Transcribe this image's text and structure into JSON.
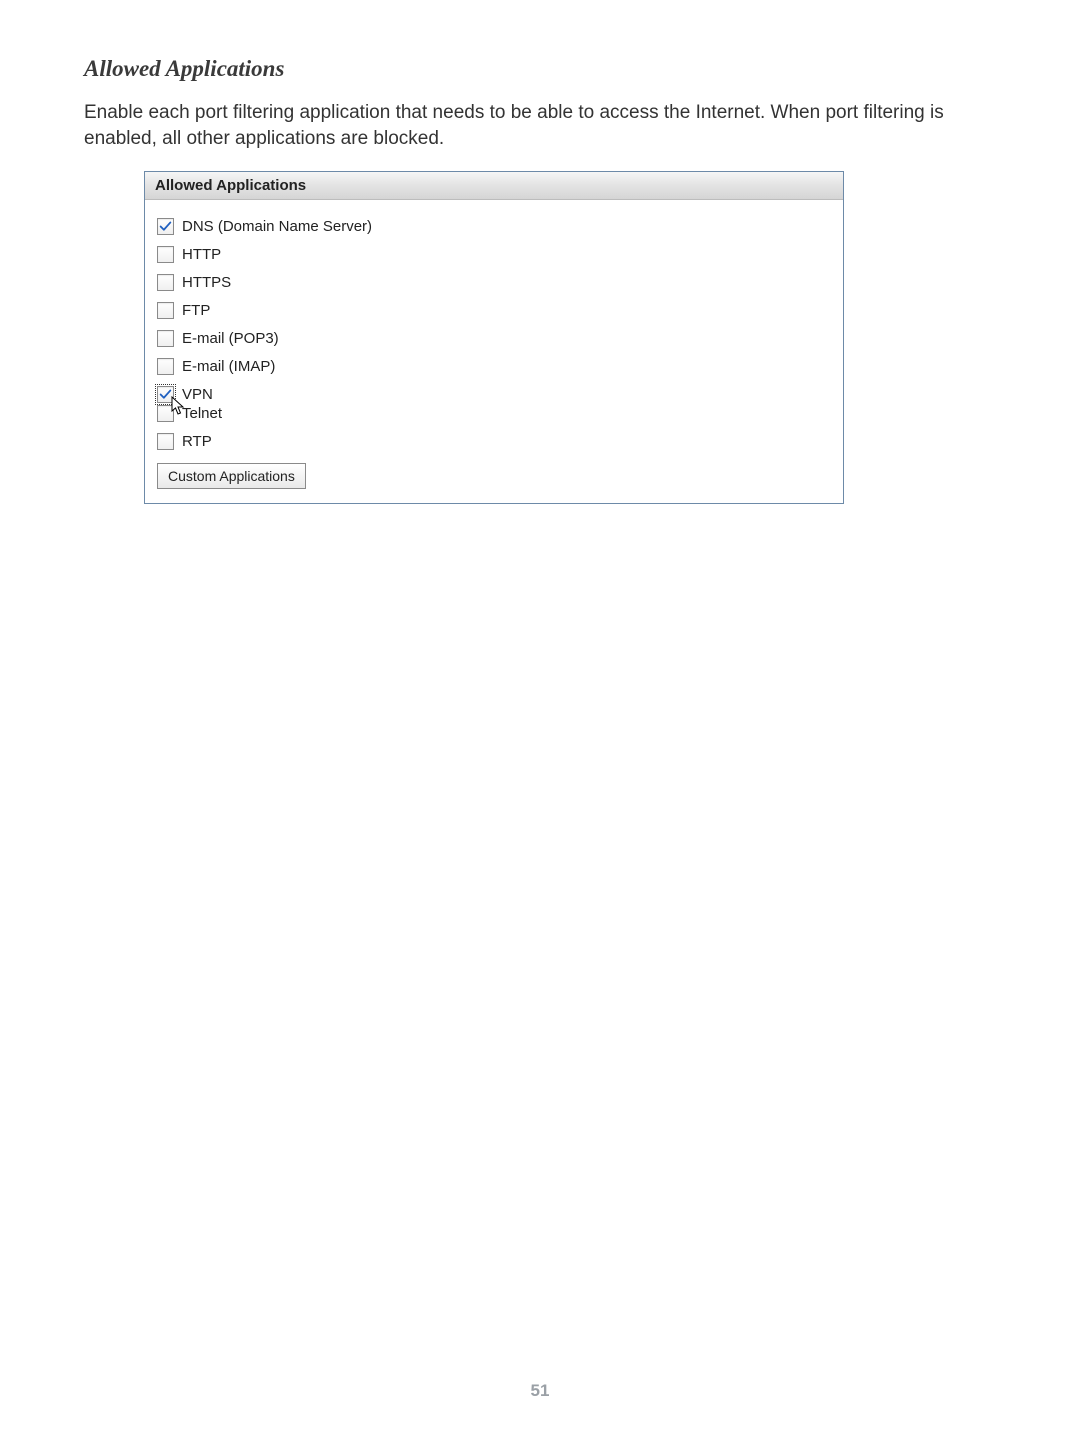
{
  "section": {
    "title": "Allowed Applications",
    "description": "Enable each port filtering application that needs to be able to access the Internet. When port filtering is enabled, all other applications are blocked."
  },
  "panel": {
    "header": "Allowed Applications",
    "items": [
      {
        "label": "DNS (Domain Name Server)",
        "checked": true,
        "focus": false
      },
      {
        "label": "HTTP",
        "checked": false,
        "focus": false
      },
      {
        "label": "HTTPS",
        "checked": false,
        "focus": false
      },
      {
        "label": "FTP",
        "checked": false,
        "focus": false
      },
      {
        "label": "E-mail (POP3)",
        "checked": false,
        "focus": false
      },
      {
        "label": "E-mail (IMAP)",
        "checked": false,
        "focus": false
      },
      {
        "label": "VPN",
        "checked": true,
        "focus": true
      },
      {
        "label": "Telnet",
        "checked": false,
        "focus": false
      },
      {
        "label": "RTP",
        "checked": false,
        "focus": false
      }
    ],
    "button_label": "Custom Applications"
  },
  "page_number": "51"
}
